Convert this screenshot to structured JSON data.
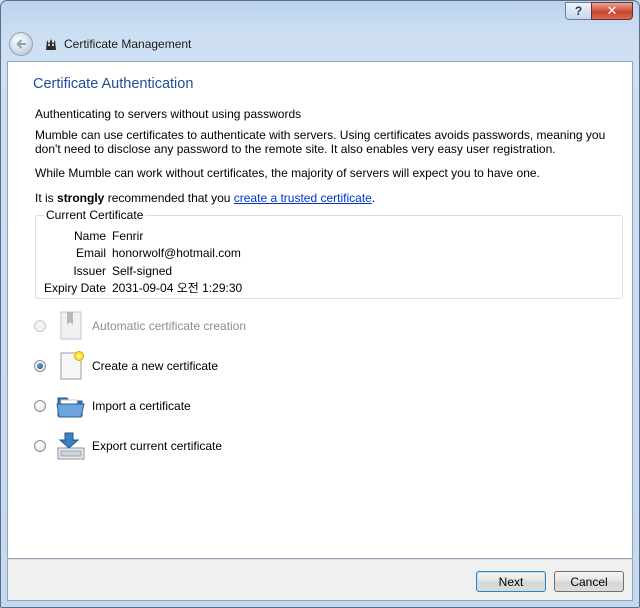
{
  "window": {
    "title": "Certificate Management",
    "help_button": "?",
    "close_button": "✕"
  },
  "page": {
    "title": "Certificate Authentication",
    "subtitle": "Authenticating to servers without using passwords",
    "description_line1": "Mumble can use certificates to authenticate with servers. Using certificates avoids passwords, meaning you",
    "description_line2": "don't need to disclose any password to the remote site. It also enables very easy user registration.",
    "note": "While Mumble can work without certificates, the majority of servers will expect you to have one.",
    "recommend_prefix": "It is ",
    "recommend_strong": "strongly",
    "recommend_mid": " recommended that you ",
    "recommend_link": "create a trusted certificate",
    "recommend_suffix": "."
  },
  "current_certificate": {
    "group_title": "Current Certificate",
    "fields": [
      {
        "key": "Name",
        "value": "Fenrir"
      },
      {
        "key": "Email",
        "value": "honorwolf@hotmail.com"
      },
      {
        "key": "Issuer",
        "value": "Self-signed"
      },
      {
        "key": "Expiry Date",
        "value": "2031-09-04 오전 1:29:30"
      }
    ]
  },
  "options": [
    {
      "label": "Automatic certificate creation",
      "icon": "certificate-gray-icon",
      "selected": false,
      "enabled": false
    },
    {
      "label": "Create a new certificate",
      "icon": "new-certificate-icon",
      "selected": true,
      "enabled": true
    },
    {
      "label": "Import a certificate",
      "icon": "open-folder-icon",
      "selected": false,
      "enabled": true
    },
    {
      "label": "Export current certificate",
      "icon": "export-tray-icon",
      "selected": false,
      "enabled": true
    }
  ],
  "buttons": {
    "next": "Next",
    "cancel": "Cancel"
  }
}
